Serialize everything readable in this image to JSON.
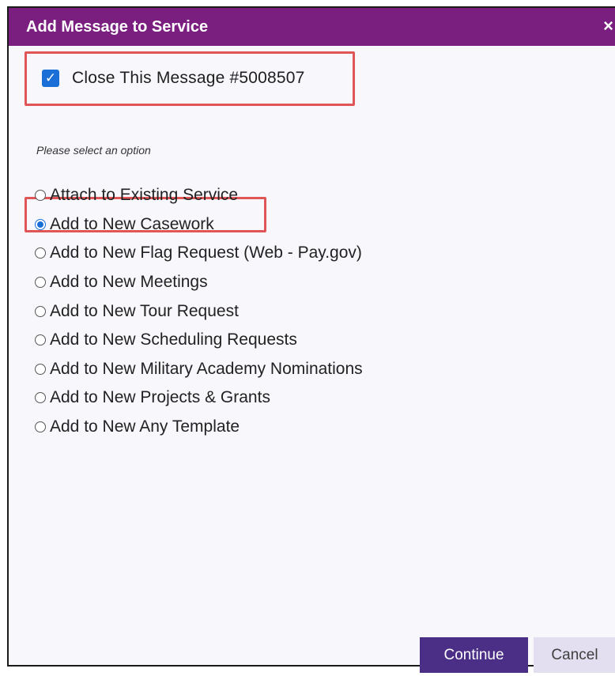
{
  "dialog": {
    "title": "Add Message to Service",
    "close_symbol": "×",
    "title_bar_color": "#7a1f80"
  },
  "close_message": {
    "checked": true,
    "label": "Close This Message #5008507"
  },
  "prompt": "Please select an option",
  "options": [
    {
      "label": "Attach to Existing Service",
      "selected": false
    },
    {
      "label": "Add to New Casework",
      "selected": true
    },
    {
      "label": "Add to New Flag Request (Web - Pay.gov)",
      "selected": false
    },
    {
      "label": "Add to New Meetings",
      "selected": false
    },
    {
      "label": "Add to New Tour Request",
      "selected": false
    },
    {
      "label": "Add to New Scheduling Requests",
      "selected": false
    },
    {
      "label": "Add to New Military Academy Nominations",
      "selected": false
    },
    {
      "label": "Add to New Projects & Grants",
      "selected": false
    },
    {
      "label": "Add to New Any Template",
      "selected": false
    }
  ],
  "buttons": {
    "continue_label": "Continue",
    "cancel_label": "Cancel",
    "continue_color": "#4b2e86",
    "cancel_color": "#e3dff0"
  },
  "highlight_color": "#e05556"
}
